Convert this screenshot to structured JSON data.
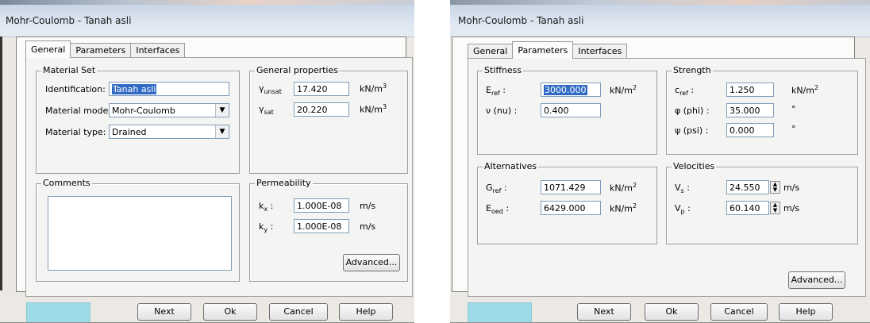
{
  "left": {
    "title": "Mohr-Coulomb - Tanah asli",
    "tabs": [
      "General",
      "Parameters",
      "Interfaces"
    ],
    "material_set": {
      "title": "Material Set",
      "identification_label": "Identification:",
      "identification_value": "Tanah asli",
      "model_label": "Material model:",
      "model_value": "Mohr-Coulomb",
      "type_label": "Material type:",
      "type_value": "Drained"
    },
    "general_properties": {
      "title": "General properties",
      "gamma_unsat": {
        "symbol": "γ",
        "sub": "unsat",
        "value": "17.420",
        "unit": "kN/m",
        "unit_sup": "3"
      },
      "gamma_sat": {
        "symbol": "γ",
        "sub": "sat",
        "value": "20.220",
        "unit": "kN/m",
        "unit_sup": "3"
      }
    },
    "comments": {
      "title": "Comments"
    },
    "permeability": {
      "title": "Permeability",
      "kx": {
        "symbol": "k",
        "sub": "x",
        "value": "1.000E-08",
        "unit": "m/s"
      },
      "ky": {
        "symbol": "k",
        "sub": "y",
        "value": "1.000E-08",
        "unit": "m/s"
      }
    },
    "advanced_button": "Advanced...",
    "buttons": {
      "next": "Next",
      "ok": "Ok",
      "cancel": "Cancel",
      "help": "Help"
    }
  },
  "right": {
    "title": "Mohr-Coulomb - Tanah asli",
    "tabs": [
      "General",
      "Parameters",
      "Interfaces"
    ],
    "stiffness": {
      "title": "Stiffness",
      "eref": {
        "symbol": "E",
        "sub": "ref",
        "value": "3000.000",
        "unit": "kN/m",
        "unit_sup": "2"
      },
      "nu": {
        "label": "ν (nu) :",
        "value": "0.400"
      }
    },
    "strength": {
      "title": "Strength",
      "cref": {
        "symbol": "c",
        "sub": "ref",
        "value": "1.250",
        "unit": "kN/m",
        "unit_sup": "2"
      },
      "phi": {
        "label": "φ (phi) :",
        "value": "35.000",
        "unit": "°"
      },
      "psi": {
        "label": "ψ (psi) :",
        "value": "0.000",
        "unit": "°"
      }
    },
    "alternatives": {
      "title": "Alternatives",
      "gref": {
        "symbol": "G",
        "sub": "ref",
        "value": "1071.429",
        "unit": "kN/m",
        "unit_sup": "2"
      },
      "eoed": {
        "symbol": "E",
        "sub": "oed",
        "value": "6429.000",
        "unit": "kN/m",
        "unit_sup": "2"
      }
    },
    "velocities": {
      "title": "Velocities",
      "vs": {
        "symbol": "V",
        "sub": "s",
        "value": "24.550",
        "unit": "m/s"
      },
      "vp": {
        "symbol": "V",
        "sub": "p",
        "value": "60.140",
        "unit": "m/s"
      }
    },
    "advanced_button": "Advanced...",
    "buttons": {
      "next": "Next",
      "ok": "Ok",
      "cancel": "Cancel",
      "help": "Help"
    }
  },
  "colors": {
    "status_swatch": "#9fdbe7",
    "selection": "#316ac5"
  }
}
